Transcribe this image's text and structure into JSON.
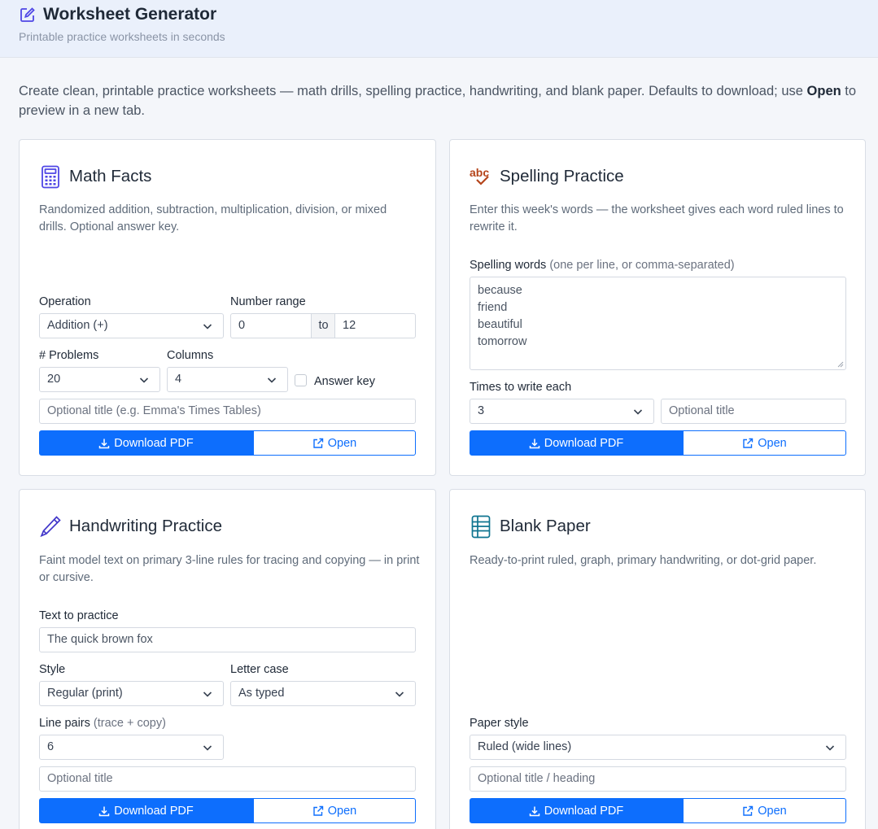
{
  "app": {
    "title": "Worksheet Generator",
    "subtitle": "Printable practice worksheets in seconds"
  },
  "intro": {
    "text_before": "Create clean, printable practice worksheets — math drills, spelling practice, handwriting, and blank paper. Defaults to download; use ",
    "bold": "Open",
    "text_after": " to preview in a new tab."
  },
  "buttons": {
    "download": "Download PDF",
    "open": "Open"
  },
  "math": {
    "title": "Math Facts",
    "description": "Randomized addition, subtraction, multiplication, division, or mixed drills. Optional answer key.",
    "operation_label": "Operation",
    "operation_value": "Addition (+)",
    "range_label": "Number range",
    "range_from": "0",
    "range_to_label": "to",
    "range_to": "12",
    "problems_label": "# Problems",
    "problems_value": "20",
    "columns_label": "Columns",
    "columns_value": "4",
    "answer_key_label": "Answer key",
    "answer_key_checked": false,
    "title_placeholder": "Optional title (e.g. Emma's Times Tables)"
  },
  "spelling": {
    "title": "Spelling Practice",
    "description": "Enter this week's words — the worksheet gives each word ruled lines to rewrite it.",
    "words_label": "Spelling words",
    "words_hint": "(one per line, or comma-separated)",
    "words": [
      "because",
      "friend",
      "beautiful",
      "tomorrow"
    ],
    "times_label": "Times to write each",
    "times_value": "3",
    "title_placeholder": "Optional title"
  },
  "handwriting": {
    "title": "Handwriting Practice",
    "description": "Faint model text on primary 3-line rules for tracing and copying — in print or cursive.",
    "text_label": "Text to practice",
    "text_value": "The quick brown fox",
    "style_label": "Style",
    "style_value": "Regular (print)",
    "case_label": "Letter case",
    "case_value": "As typed",
    "pairs_label": "Line pairs",
    "pairs_hint": "(trace + copy)",
    "pairs_value": "6",
    "title_placeholder": "Optional title"
  },
  "blank": {
    "title": "Blank Paper",
    "description": "Ready-to-print ruled, graph, primary handwriting, or dot-grid paper.",
    "style_label": "Paper style",
    "style_value": "Ruled (wide lines)",
    "title_placeholder": "Optional title / heading"
  },
  "colors": {
    "primary": "#0d6efd",
    "header_bg": "#eaf0fb",
    "page_bg": "#f4f6fa"
  },
  "icons": {
    "app": "edit-icon",
    "math": "calculator-icon",
    "spelling": "spellcheck-icon",
    "handwriting": "pencil-icon",
    "blank": "ruled-paper-icon",
    "download": "download-icon",
    "open": "external-link-icon",
    "select": "chevron-down-icon"
  }
}
